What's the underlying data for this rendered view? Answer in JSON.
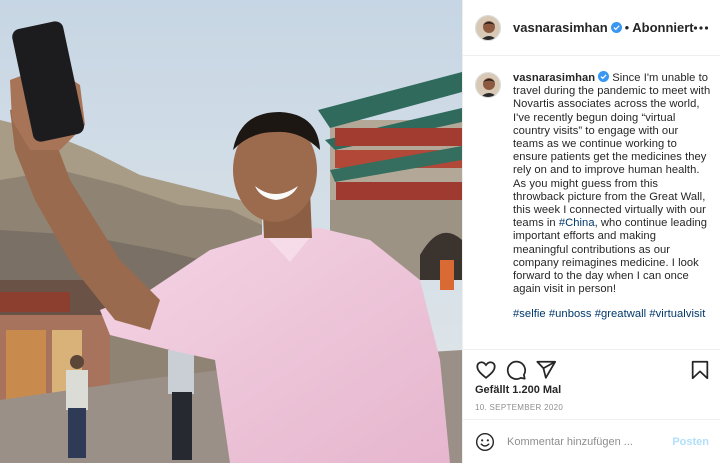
{
  "post": {
    "username": "vasnarasimhan",
    "follow_state": "Abonniert",
    "separator": "•",
    "caption_text": "Since I'm unable to travel during the pandemic to meet with Novartis associates across the world, I've recently begun doing “virtual country visits” to engage with our teams as we continue working to ensure patients get the medicines they rely on and to improve human health. As you might guess from this throwback picture from the Great Wall, this week I connected virtually with our teams in ",
    "caption_mention": "#China",
    "caption_text_end": ", who continue leading important efforts and making meaningful contributions as our company reimagines medicine. I look forward to the day when I can once again visit in person!",
    "hashtags": [
      "#selfie",
      "#unboss",
      "#greatwall",
      "#virtualvisit"
    ],
    "likes": "Gefällt 1.200 Mal",
    "date": "10. September 2020",
    "comment_placeholder": "Kommentar hinzufügen ...",
    "post_button": "Posten"
  },
  "colors": {
    "link": "#00376b",
    "verified": "#3897f0",
    "post_disabled": "#b2dffc",
    "meta": "#8e8e8e"
  },
  "icons": [
    "verified-badge-icon",
    "more-options-icon",
    "heart-icon",
    "comment-icon",
    "share-icon",
    "bookmark-icon",
    "emoji-icon"
  ]
}
